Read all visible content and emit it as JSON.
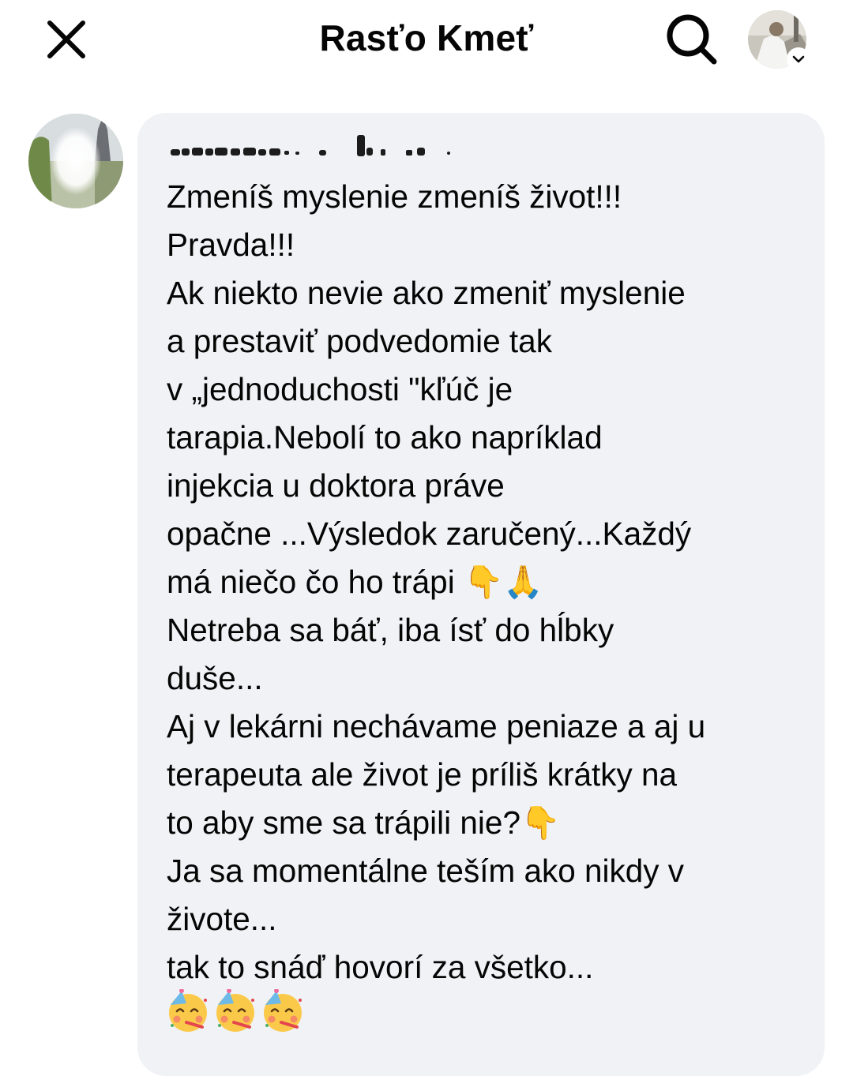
{
  "header": {
    "title": "Rasťo Kmeť",
    "close_icon": "close-icon",
    "search_icon": "search-icon",
    "profile_icon": "avatar",
    "chevron_icon": "chevron-down-icon"
  },
  "comment": {
    "author_name_obscured": true,
    "text": "Zmeníš myslenie zmeníš život!!!\nPravda!!!\nAk niekto nevie ako zmeniť myslenie\na prestaviť podvedomie tak\nv „jednoduchosti \"kľúč je\ntarapia.Nebolí to ako napríklad\ninjekcia u doktora práve\nopačne ...Výsledok zaručený...Každý\nmá niečo čo ho trápi 👇🙏\nNetreba sa báť, iba ísť do hĺbky\nduše...\nAj v lekárni nechávame peniaze a aj u\nterapeuta ale život je príliš krátky na\nto aby sme sa trápili nie?👇\nJa sa momentálne teším ako nikdy v\nživote...\ntak to snáď hovorí za všetko...",
    "emojis": [
      "partying-face-emoji",
      "partying-face-emoji",
      "partying-face-emoji"
    ]
  },
  "colors": {
    "bubble_bg": "#f0f2f5",
    "text": "#050505",
    "emoji_yellow": "#fbc94a"
  }
}
